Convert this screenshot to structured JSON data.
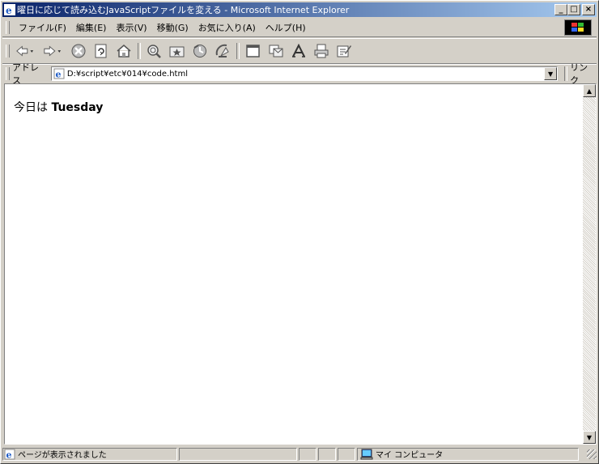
{
  "window": {
    "title": "曜日に応じて読み込むJavaScriptファイルを変える - Microsoft Internet Explorer",
    "buttons": {
      "minimize": "_",
      "maximize": "□",
      "close": "×"
    }
  },
  "menubar": {
    "items": [
      "ファイル(F)",
      "編集(E)",
      "表示(V)",
      "移動(G)",
      "お気に入り(A)",
      "ヘルプ(H)"
    ]
  },
  "toolbar": {
    "icons": [
      "back-icon",
      "forward-icon",
      "stop-icon",
      "refresh-icon",
      "home-icon",
      "search-icon",
      "favorites-icon",
      "history-icon",
      "channels-icon",
      "fullscreen-icon",
      "mail-icon",
      "font-icon",
      "print-icon",
      "edit-icon"
    ]
  },
  "addressbar": {
    "label": "アドレス",
    "value": "D:¥script¥etc¥014¥code.html",
    "links_label": "リンク"
  },
  "content": {
    "prefix": "今日は",
    "day": "Tuesday"
  },
  "statusbar": {
    "message": "ページが表示されました",
    "zone": "マイ コンピュータ"
  }
}
